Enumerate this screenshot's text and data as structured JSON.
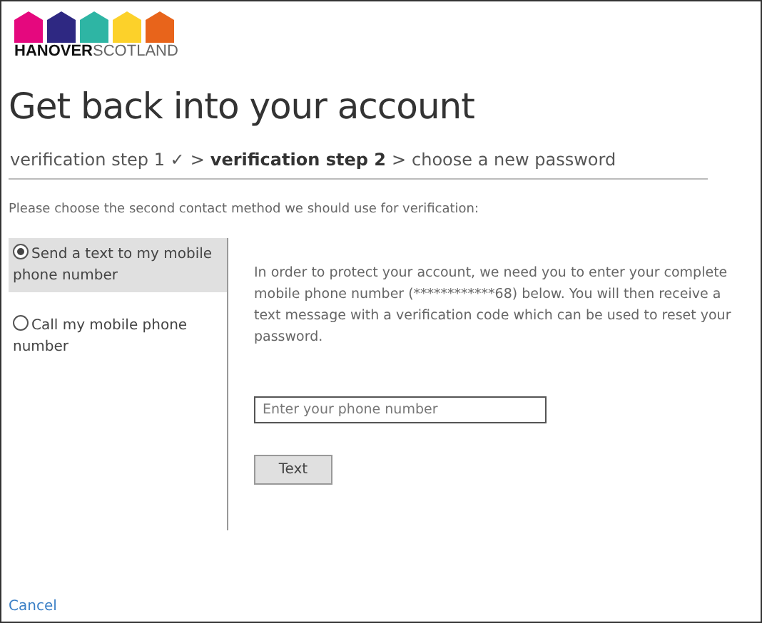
{
  "logo": {
    "brand": "HANOVER",
    "region": "SCOTLAND"
  },
  "title": "Get back into your account",
  "steps": [
    {
      "kind": "step",
      "label": "verification step 1 ✓",
      "current": false
    },
    {
      "kind": "separator",
      "label": ">"
    },
    {
      "kind": "step",
      "label": "verification step 2",
      "current": true
    },
    {
      "kind": "separator",
      "label": ">"
    },
    {
      "kind": "step",
      "label": "choose a new password",
      "current": false
    }
  ],
  "instruction": "Please choose the second contact method we should use for verification:",
  "options": [
    {
      "label": "Send a text to my mobile phone number",
      "selected": true
    },
    {
      "label": "Call my mobile phone number",
      "selected": false
    }
  ],
  "message": "In order to protect your account, we need you to enter your complete mobile phone number (************68) below. You will then receive a text message with a verification code which can be used to reset your password.",
  "phone_field": {
    "placeholder": "Enter your phone number"
  },
  "submit_button": "Text",
  "cancel_link": "Cancel"
}
